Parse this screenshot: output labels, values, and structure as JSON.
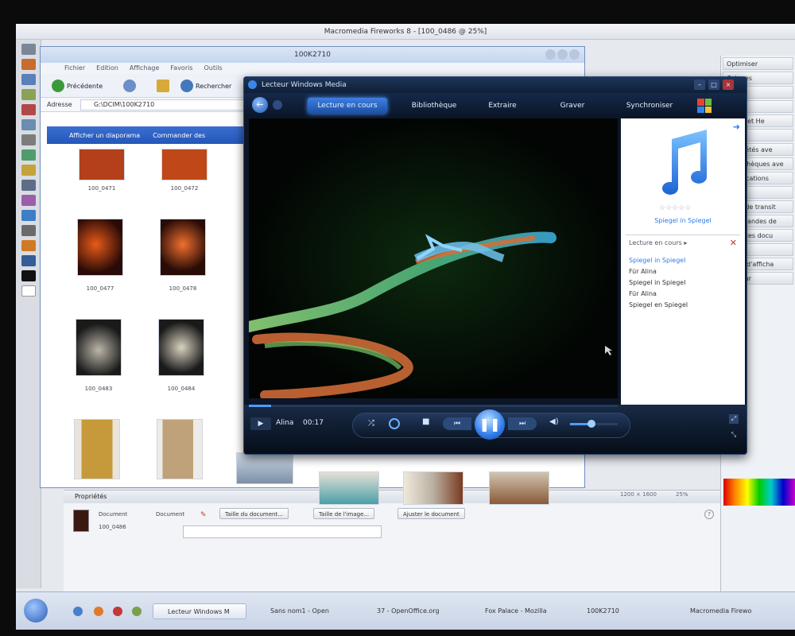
{
  "fireworks": {
    "title": "Macromedia Fireworks 8 - [100_0486 @ 25%]",
    "panels": [
      "Optimiser",
      "Calques",
      "",
      "Image",
      "Pages et He",
      "Styles",
      "Propriétés ave",
      "Bibliothèques ave",
      "Modifications",
      "",
      "Ajout de transit",
      "Commandes de",
      "Page des docu",
      "",
      "Choix d'afficha",
      "Couleur"
    ],
    "size_readout": "1200 × 1600",
    "zoom": "25%"
  },
  "properties": {
    "header": "Propriétés",
    "doc_label": "Document",
    "doc_name": "100_0486",
    "doc_label2": "Document",
    "btn_canvas_size": "Taille du document...",
    "btn_image_size": "Taille de l'image...",
    "btn_fit": "Ajuster le document"
  },
  "explorer": {
    "title": "100K2710",
    "menu": [
      "Fichier",
      "Edition",
      "Affichage",
      "Favoris",
      "Outils"
    ],
    "back_label": "Précédente",
    "search_label": "Rechercher",
    "address_label": "Adresse",
    "address_value": "G:\\DCIM\\100K2710",
    "banner_slideshow": "Afficher un diaporama",
    "banner_order": "Commander des",
    "thumbs": [
      {
        "label": "100_0471",
        "color": "#b3401a"
      },
      {
        "label": "100_0472",
        "color": "#c04818"
      },
      {
        "label": "100_0477",
        "color": "#8a2a10"
      },
      {
        "label": "100_0478",
        "color": "#a04020"
      },
      {
        "label": "100_0483",
        "color": "#6d6a66"
      },
      {
        "label": "100_0484",
        "color": "#8d8679"
      }
    ]
  },
  "taskbar": {
    "items": [
      "Lecteur Windows M",
      "Sans nom1 - Open",
      "37 - OpenOffice.org",
      "Fox Palace - Mozilla",
      "100K2710",
      "Macromedia Firewo"
    ]
  },
  "wmp": {
    "title": "Lecteur Windows Media",
    "tabs": [
      "Lecture en cours",
      "Bibliothèque",
      "Extraire",
      "Graver",
      "Synchroniser"
    ],
    "active_tab": 0,
    "album_caption": "Spiegel in Spiegel",
    "list_header": "Lecture en cours",
    "playlist": [
      "Spiegel in Spiegel",
      "Für Alina",
      "Spiegel in Spiegel",
      "Für Alina",
      "Spiegel en Spiegel"
    ],
    "current_track": 0,
    "now_playing": "Alina",
    "time": "00:17",
    "volume": 0.45,
    "accent_color": "#2f7bea"
  }
}
